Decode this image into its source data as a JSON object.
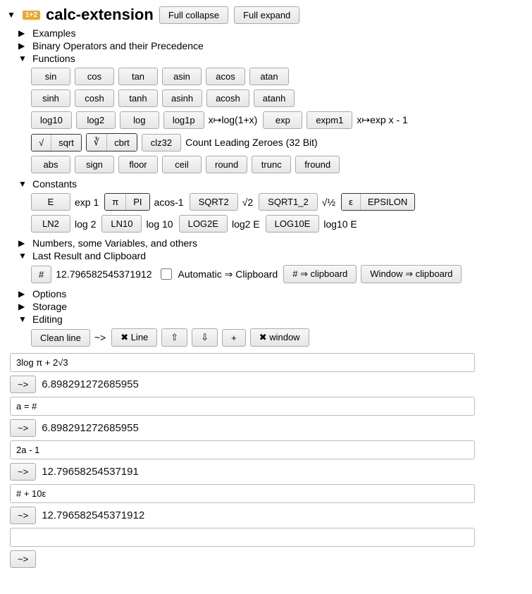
{
  "header": {
    "badge": "1+2",
    "title": "calc-extension",
    "collapse_btn": "Full collapse",
    "expand_btn": "Full expand"
  },
  "sections": {
    "examples": "Examples",
    "operators": "Binary Operators and their Precedence",
    "functions": "Functions",
    "constants": "Constants",
    "numbers": "Numbers, some Variables, and others",
    "lastresult": "Last Result and Clipboard",
    "options": "Options",
    "storage": "Storage",
    "editing": "Editing"
  },
  "functions": {
    "row1": [
      "sin",
      "cos",
      "tan",
      "asin",
      "acos",
      "atan"
    ],
    "row2": [
      "sinh",
      "cosh",
      "tanh",
      "asinh",
      "acosh",
      "atanh"
    ],
    "row3": {
      "log10": "log10",
      "log2": "log2",
      "log": "log",
      "log1p": "log1p",
      "log1p_note": "x↦log(1+x)",
      "exp": "exp",
      "expm1": "expm1",
      "expm1_note": "x↦exp x - 1"
    },
    "row4": {
      "sqrt_sym": "√",
      "sqrt": "sqrt",
      "cbrt_sym": "∛",
      "cbrt": "cbrt",
      "clz32": "clz32",
      "clz32_note": "Count Leading Zeroes (32 Bit)"
    },
    "row5": [
      "abs",
      "sign",
      "floor",
      "ceil",
      "round",
      "trunc",
      "fround"
    ]
  },
  "constants": {
    "e": "E",
    "e_note": "exp 1",
    "pi_sym": "π",
    "pi": "PI",
    "pi_note": "acos-1",
    "sqrt2": "SQRT2",
    "sqrt2_note": "√2",
    "sqrt12": "SQRT1_2",
    "sqrt12_note": "√½",
    "eps_sym": "ε",
    "eps": "EPSILON",
    "ln2": "LN2",
    "ln2_note": "log 2",
    "ln10": "LN10",
    "ln10_note": "log 10",
    "log2e": "LOG2E",
    "log2e_note": "log2 E",
    "log10e": "LOG10E",
    "log10e_note": "log10 E"
  },
  "lastresult": {
    "hash": "#",
    "hash_val": "12.796582545371912",
    "auto_label": "Automatic ⇒ Clipboard",
    "hash_clip": "# ⇒ clipboard",
    "win_clip": "Window ⇒ clipboard"
  },
  "editing": {
    "clean": "Clean line",
    "tilde": "~>",
    "line_btn": "Line",
    "up": "⇧",
    "down": "⇩",
    "plus": "+",
    "window": "window",
    "expr1": "3log π + 2√3",
    "res1": "6.898291272685955",
    "expr2": "a = #",
    "res2": "6.898291272685955",
    "expr3": "2a - 1",
    "res3": "12.79658254537191",
    "expr4": "# + 10ε",
    "res4": "12.796582545371912",
    "expr5": ""
  }
}
